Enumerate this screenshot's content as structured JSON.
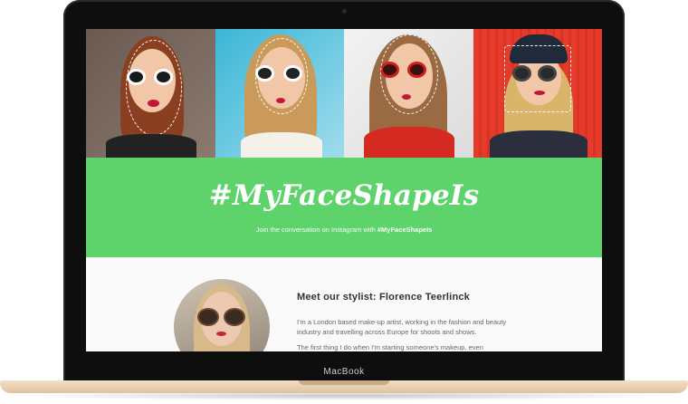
{
  "device": {
    "brand_label": "MacBook"
  },
  "photos": [
    {
      "name": "model-white-sunglasses"
    },
    {
      "name": "model-cat-eye-sunglasses"
    },
    {
      "name": "model-red-heart-sunglasses"
    },
    {
      "name": "model-beanie-sunglasses"
    }
  ],
  "banner": {
    "hashtag": "#MyFaceShapeIs",
    "subline_prefix": "Join the conversation on Instagram with ",
    "subline_tag": "#MyFaceShapeIs"
  },
  "stylist": {
    "title": "Meet our stylist: Florence Teerlinck",
    "paragraph_1": "I'm a London based make-up artist, working in the fashion and beauty industry and travelling across Europe for shoots and shows.",
    "paragraph_2": "The first thing I do when I'm starting someone's makeup, even"
  },
  "colors": {
    "accent_green": "#5ed36b",
    "laptop_gold": "#e7ccab"
  }
}
